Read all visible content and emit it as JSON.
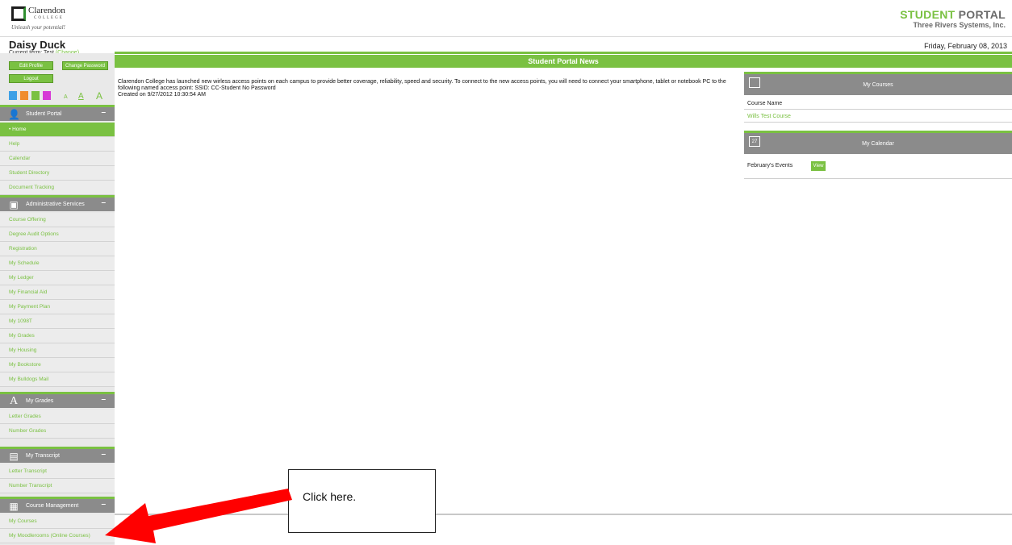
{
  "logo": {
    "name": "Clarendon",
    "college": "COLLEGE",
    "tagline": "Unleash your potential!"
  },
  "brand": {
    "title_a": "STUDENT",
    "title_b": " PORTAL",
    "subtitle": "Three Rivers Systems, Inc."
  },
  "user": {
    "name": "Daisy Duck",
    "term_label": "Current term: Test",
    "term_change": "(Change)"
  },
  "date": "Friday, February 08, 2013",
  "profile_buttons": {
    "edit": "Edit Profile",
    "change_password": "Change Password",
    "logout": "Logout"
  },
  "swatches": [
    "#3ea0e6",
    "#f08c2e",
    "#7ac142",
    "#d63ad6"
  ],
  "font_sizes": [
    "A",
    "A",
    "A"
  ],
  "sections": [
    {
      "title": "Student Portal",
      "icon": "person-icon",
      "toggle": "–",
      "items": [
        "Home",
        "Help",
        "Calendar",
        "Student Directory",
        "Document Tracking"
      ]
    },
    {
      "title": "Administrative Services",
      "icon": "admin-icon",
      "toggle": "–",
      "items": [
        "Course Offering",
        "Degree Audit Options",
        "Registration",
        "My Schedule",
        "My Ledger",
        "My Financial Aid",
        "My Payment Plan",
        "My 1098T",
        "My Grades",
        "My Housing",
        "My Bookstore",
        "My Bulldogs Mail"
      ]
    },
    {
      "title": "My Grades",
      "icon": "letter-a-icon",
      "toggle": "–",
      "items": [
        "Letter Grades",
        "Number Grades"
      ]
    },
    {
      "title": "My Transcript",
      "icon": "document-icon",
      "toggle": "–",
      "items": [
        "Letter Transcript",
        "Number Transcript"
      ]
    },
    {
      "title": "Course Management",
      "icon": "course-icon",
      "toggle": "–",
      "items": [
        "My Courses",
        "My Moodlerooms (Online Courses)"
      ]
    }
  ],
  "active_item": "Home",
  "news": {
    "header": "Student Portal News",
    "body": "Clarendon College has launched new wirless access points on each campus to provide better coverage, reliability, speed and security. To connect to the new access points, you will need to connect your smartphone, tablet or notebook PC to the following named access point: SSID: CC-Student No Password",
    "created": "Created on 9/27/2012 10:30:54 AM"
  },
  "my_courses": {
    "title": "My Courses",
    "column": "Course Name",
    "course": "Wills Test Course"
  },
  "my_calendar": {
    "title": "My Calendar",
    "icon_text": "27",
    "events_label": "February's Events",
    "view_button": "View"
  },
  "callout": {
    "text": "Click here."
  },
  "colors": {
    "accent": "#7ac142",
    "section_bg": "#8b8b8b",
    "arrow": "#ff0000"
  }
}
